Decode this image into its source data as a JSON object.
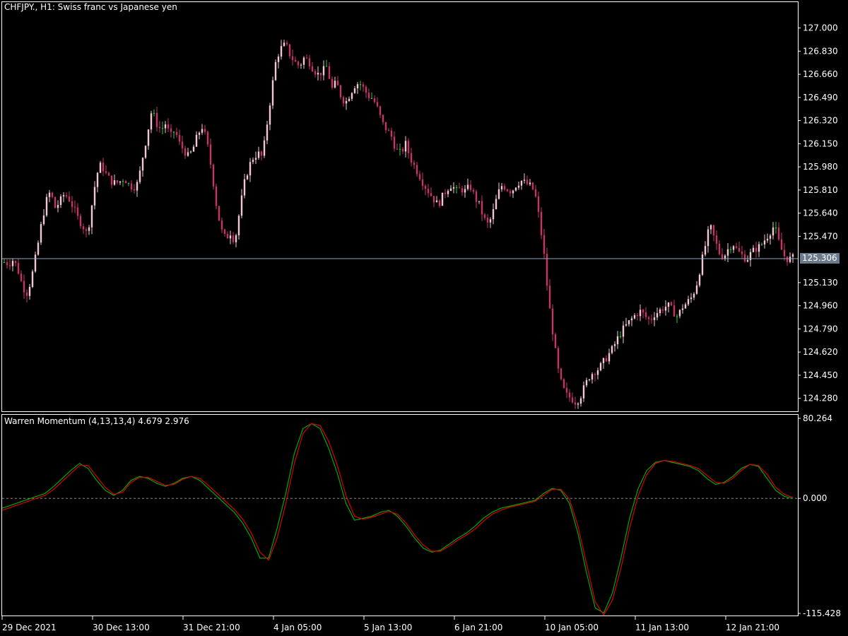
{
  "chart_data": [
    {
      "type": "candlestick",
      "title": "CHFJPY., H1:  Swiss franc vs Japanese yen",
      "price_axis_ticks": [
        "127.000",
        "126.830",
        "126.660",
        "126.490",
        "126.320",
        "126.150",
        "125.980",
        "125.810",
        "125.640",
        "125.470",
        "125.130",
        "124.960",
        "124.790",
        "124.620",
        "124.450",
        "124.280"
      ],
      "ylim": [
        124.185,
        127.19
      ],
      "current_price": "125.306",
      "time_axis_ticks": [
        "29 Dec 2021",
        "30 Dec 13:00",
        "31 Dec 21:00",
        "4 Jan 05:00",
        "5 Jan 13:00",
        "6 Jan 21:00",
        "10 Jan 05:00",
        "11 Jan 13:00",
        "12 Jan 21:00"
      ],
      "close_path": [
        125.28,
        125.27,
        125.3,
        125.22,
        125.1,
        125.05,
        125.18,
        125.35,
        125.55,
        125.72,
        125.8,
        125.68,
        125.72,
        125.78,
        125.75,
        125.68,
        125.6,
        125.55,
        125.48,
        125.7,
        125.92,
        126.0,
        125.93,
        125.88,
        125.86,
        125.87,
        125.9,
        125.85,
        125.83,
        125.86,
        126.05,
        126.22,
        126.4,
        126.3,
        126.25,
        126.3,
        126.2,
        126.25,
        126.15,
        126.1,
        126.05,
        126.12,
        126.22,
        126.28,
        126.15,
        125.95,
        125.7,
        125.52,
        125.45,
        125.5,
        125.43,
        125.65,
        125.85,
        125.98,
        126.05,
        126.08,
        126.05,
        126.3,
        126.55,
        126.78,
        126.85,
        126.88,
        126.8,
        126.75,
        126.72,
        126.78,
        126.76,
        126.7,
        126.66,
        126.68,
        126.72,
        126.55,
        126.6,
        126.5,
        126.45,
        126.52,
        126.58,
        126.6,
        126.55,
        126.5,
        126.48,
        126.4,
        126.3,
        126.25,
        126.2,
        126.1,
        126.08,
        126.15,
        126.05,
        125.98,
        125.92,
        125.85,
        125.8,
        125.75,
        125.7,
        125.76,
        125.82,
        125.85,
        125.8,
        125.82,
        125.8,
        125.84,
        125.76,
        125.7,
        125.6,
        125.55,
        125.65,
        125.78,
        125.85,
        125.82,
        125.8,
        125.85,
        125.88,
        125.86,
        125.84,
        125.8,
        125.6,
        125.35,
        125.0,
        124.75,
        124.5,
        124.36,
        124.3,
        124.28,
        124.25,
        124.3,
        124.38,
        124.45,
        124.48,
        124.5,
        124.55,
        124.6,
        124.65,
        124.72,
        124.78,
        124.82,
        124.86,
        124.9,
        124.92,
        124.88,
        124.85,
        124.9,
        124.92,
        124.95,
        124.96,
        124.92,
        124.88,
        124.95,
        124.98,
        125.02,
        125.1,
        125.25,
        125.4,
        125.55,
        125.45,
        125.35,
        125.32,
        125.38,
        125.42,
        125.36,
        125.33,
        125.3,
        125.35,
        125.38,
        125.4,
        125.45,
        125.5,
        125.55,
        125.42,
        125.33,
        125.3,
        125.31
      ],
      "last_bars": "125.31"
    },
    {
      "type": "line",
      "title": "Warren Momentum (4,13,13,4) 4.679 2.976",
      "axis_ticks": [
        "80.264",
        "0.000",
        "-115.428"
      ],
      "ylim": [
        -115.428,
        80.264
      ],
      "series": [
        {
          "color": "#00aa00",
          "values": [
            -10,
            -7,
            -4,
            -1,
            2,
            5,
            12,
            20,
            28,
            35,
            30,
            18,
            8,
            3,
            8,
            18,
            22,
            20,
            15,
            12,
            15,
            20,
            22,
            18,
            10,
            2,
            -6,
            -14,
            -25,
            -40,
            -60,
            -60,
            -30,
            5,
            45,
            70,
            75,
            70,
            50,
            25,
            -5,
            -22,
            -20,
            -18,
            -14,
            -12,
            -18,
            -28,
            -40,
            -50,
            -54,
            -52,
            -46,
            -40,
            -35,
            -28,
            -20,
            -14,
            -10,
            -8,
            -6,
            -4,
            -2,
            5,
            10,
            8,
            -5,
            -35,
            -75,
            -110,
            -115,
            -95,
            -60,
            -20,
            10,
            28,
            36,
            38,
            36,
            34,
            32,
            28,
            20,
            14,
            16,
            22,
            30,
            34,
            32,
            20,
            8,
            2,
            0
          ]
        },
        {
          "color": "#dd0000",
          "values": [
            -12,
            -9,
            -6,
            -3,
            0,
            3,
            9,
            17,
            25,
            33,
            33,
            22,
            11,
            4,
            6,
            16,
            21,
            21,
            17,
            13,
            14,
            19,
            22,
            20,
            13,
            5,
            -3,
            -11,
            -21,
            -35,
            -54,
            -62,
            -40,
            -5,
            35,
            65,
            75,
            73,
            57,
            33,
            3,
            -18,
            -21,
            -19,
            -16,
            -13,
            -16,
            -25,
            -37,
            -47,
            -53,
            -53,
            -48,
            -42,
            -37,
            -31,
            -23,
            -16,
            -12,
            -9,
            -7,
            -5,
            -3,
            3,
            9,
            9,
            -1,
            -28,
            -66,
            -104,
            -117,
            -102,
            -70,
            -30,
            3,
            24,
            35,
            38,
            37,
            35,
            33,
            30,
            23,
            16,
            15,
            20,
            28,
            34,
            33,
            24,
            11,
            4,
            1
          ]
        }
      ],
      "zero_line": "0.000"
    }
  ],
  "colors": {
    "background": "#000000",
    "candle_bear": "#c8336a",
    "candle_bull": "#f2c8d6",
    "candle_flat": "#32cd32",
    "grid_frame": "#ffffff",
    "price_line": "#8fa6c0",
    "signal_green": "#00aa00",
    "signal_red": "#dd0000"
  }
}
